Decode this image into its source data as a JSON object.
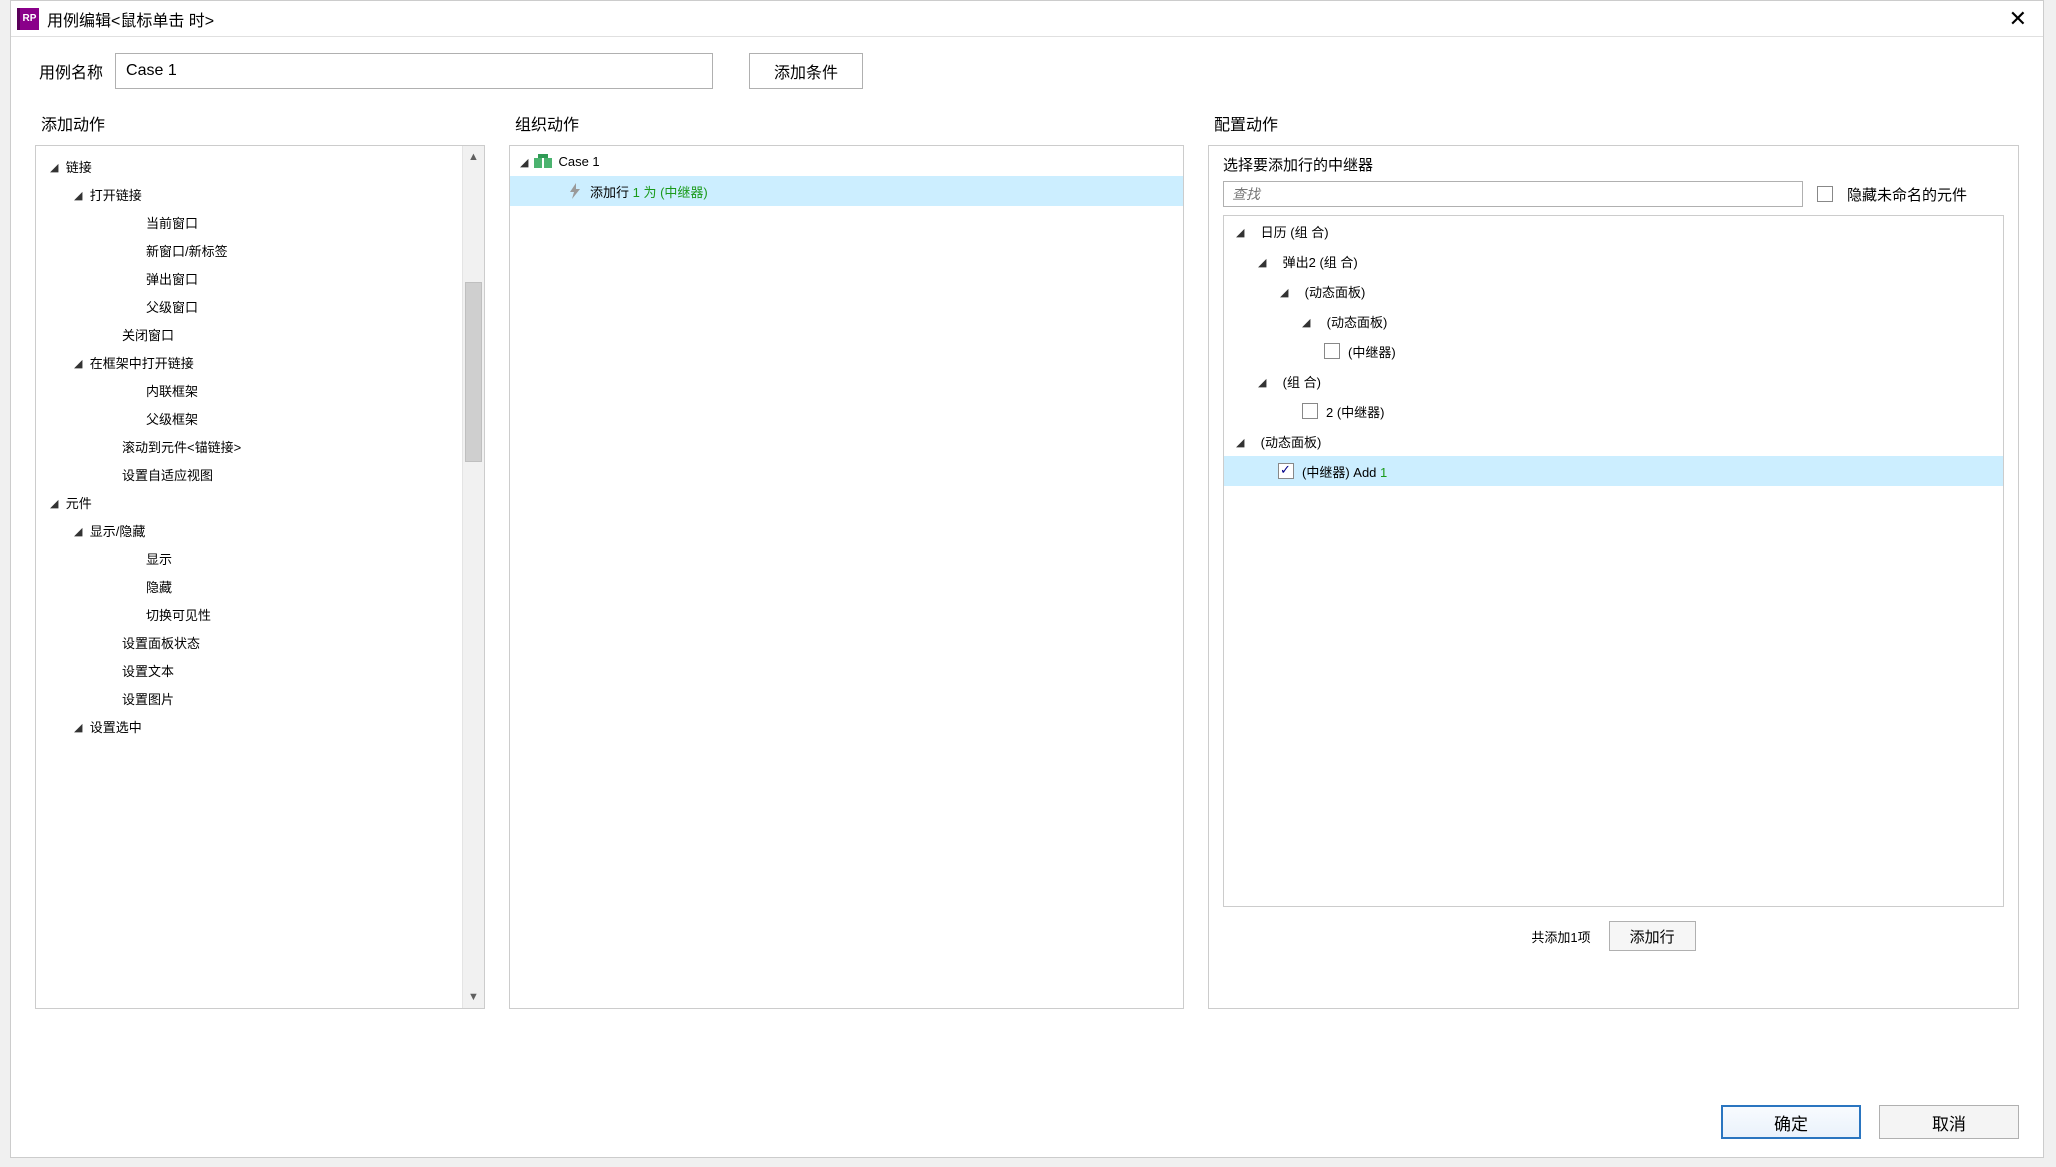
{
  "window_title": "用例编辑<鼠标单击 时>",
  "name_label": "用例名称",
  "name_value": "Case 1",
  "add_condition_btn": "添加条件",
  "col1_title": "添加动作",
  "col2_title": "组织动作",
  "col3_title": "配置动作",
  "action_tree": {
    "links": "链接",
    "open_link": "打开链接",
    "current_window": "当前窗口",
    "new_window_tab": "新窗口/新标签",
    "popup_window": "弹出窗口",
    "parent_window": "父级窗口",
    "close_window": "关闭窗口",
    "open_in_frame": "在框架中打开链接",
    "inline_frame": "内联框架",
    "parent_frame": "父级框架",
    "scroll_to_anchor": "滚动到元件<锚链接>",
    "set_adaptive": "设置自适应视图",
    "widgets": "元件",
    "show_hide": "显示/隐藏",
    "show": "显示",
    "hide": "隐藏",
    "toggle_visibility": "切换可见性",
    "set_panel_state": "设置面板状态",
    "set_text": "设置文本",
    "set_image": "设置图片",
    "set_selected": "设置选中"
  },
  "org_tree": {
    "case_name": "Case 1",
    "action_prefix": "添加行 ",
    "action_mid": "1 为 ",
    "action_suffix": "(中继器)"
  },
  "config": {
    "header": "选择要添加行的中继器",
    "search_placeholder": "查找",
    "hide_unnamed": "隐藏未命名的元件",
    "tree": {
      "calendar": "日历 (组 合)",
      "popup2": "弹出2 (组 合)",
      "dp1": "(动态面板)",
      "dp2": "(动态面板)",
      "repeater1": "(中继器)",
      "group2": "(组 合)",
      "repeater2": "2 (中继器)",
      "dp3": "(动态面板)",
      "repeater_add_pre": "(中继器) Add ",
      "repeater_add_num": "1"
    },
    "footer_count": "共添加1项",
    "add_row_btn": "添加行"
  },
  "buttons": {
    "ok": "确定",
    "cancel": "取消"
  }
}
